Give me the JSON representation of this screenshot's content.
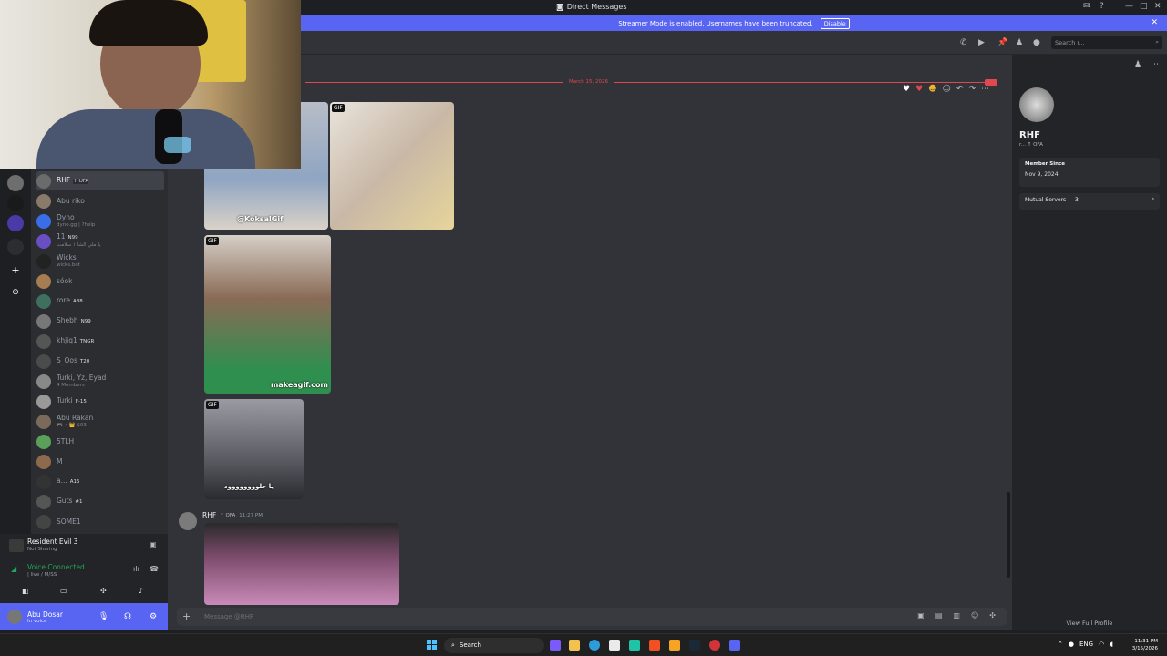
{
  "titlebar": {
    "title": "Direct Messages"
  },
  "banner": {
    "text": "Streamer Mode is enabled. Usernames have been truncated.",
    "disable_label": "Disable"
  },
  "toolbar": {
    "search_placeholder": "Search r..."
  },
  "divider": {
    "date": "March 15, 2026"
  },
  "dm_list": [
    {
      "name": "RHF",
      "tag": "↑ OFA",
      "sub": "",
      "color": "#6b6b6b",
      "active": true
    },
    {
      "name": "Abu riko",
      "tag": "",
      "sub": "",
      "color": "#8a7a6a"
    },
    {
      "name": "Dyno",
      "tag": "",
      "sub": "dyno.gg | ?help",
      "color": "#3a6ee8"
    },
    {
      "name": "11",
      "tag": "N99",
      "sub": "يا ملي الشا ۱ سلامت",
      "color": "#6a4fc4"
    },
    {
      "name": "Wicks",
      "tag": "",
      "sub": "wicks.bot",
      "color": "#222"
    },
    {
      "name": "sóok",
      "tag": "",
      "sub": "",
      "color": "#a67c52"
    },
    {
      "name": "rore",
      "tag": "A88",
      "sub": "",
      "color": "#3f6f5f"
    },
    {
      "name": "Shebh",
      "tag": "N99",
      "sub": "",
      "color": "#777"
    },
    {
      "name": "khjjq1",
      "tag": "TNGR",
      "sub": "",
      "color": "#555"
    },
    {
      "name": "S_Oos",
      "tag": "T20",
      "sub": "",
      "color": "#4b4b4b"
    },
    {
      "name": "Turki, Yz, Eyad",
      "tag": "",
      "sub": "4 Members",
      "color": "#888"
    },
    {
      "name": "Turki",
      "tag": "F-15",
      "sub": "",
      "color": "#999"
    },
    {
      "name": "Abu Rakan",
      "tag": "",
      "sub": "🎮 ∙ 👑 $03",
      "color": "#7a6a5a"
    },
    {
      "name": "5TLH",
      "tag": "",
      "sub": "",
      "color": "#5aa05a"
    },
    {
      "name": "M",
      "tag": "",
      "sub": "",
      "color": "#8b6b4b"
    },
    {
      "name": "a...",
      "tag": "A15",
      "sub": "",
      "color": "#333"
    },
    {
      "name": "Guts",
      "tag": "#1",
      "sub": "",
      "color": "#555"
    },
    {
      "name": "SOME1",
      "tag": "",
      "sub": "",
      "color": "#444"
    }
  ],
  "activity": {
    "title": "Resident Evil 3",
    "status": "Not Sharing"
  },
  "voice": {
    "status": "Voice Connected",
    "channel": "| live / M/SS"
  },
  "user": {
    "name": "Abu Dosar",
    "status": "In voice"
  },
  "gifs": [
    {
      "tag": "GIF",
      "watermark": "@KoksalGif"
    },
    {
      "tag": "GIF",
      "watermark": ""
    },
    {
      "tag": "GIF",
      "watermark": "makeagif.com"
    },
    {
      "tag": "GIF",
      "watermark": "يا حلوووووووود"
    }
  ],
  "message": {
    "author": "RHF",
    "tag": "↑ OFA",
    "time": "11:27 PM"
  },
  "composer": {
    "placeholder": "Message @RHF"
  },
  "profile": {
    "name": "RHF",
    "tagline": "r... ↑ OFA",
    "member_since_label": "Member Since",
    "member_since": "Nov 9, 2024",
    "mutual": "Mutual Servers — 3",
    "view_full": "View Full Profile"
  },
  "taskbar": {
    "search": "Search",
    "lang": "ENG",
    "time": "11:31 PM",
    "date": "3/15/2026"
  },
  "colors": {
    "blurple": "#5865f2",
    "bg": "#313338",
    "red": "#e0484f",
    "green": "#23a55a"
  }
}
